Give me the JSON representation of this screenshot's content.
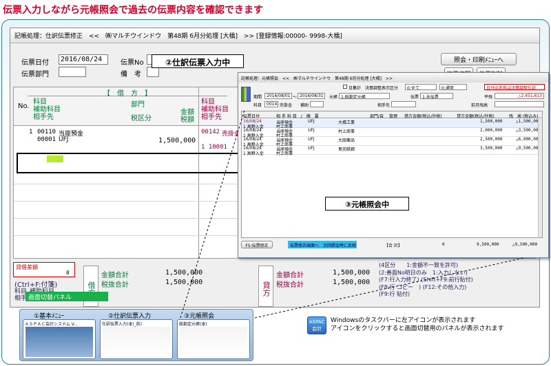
{
  "header": "伝票入力しながら元帳照会で過去の伝票内容を確認できます",
  "main": {
    "title": "記帳処理：仕訳伝票修正　<<　㈱マルチウインドウ　第48期 6月分処理 [大橋]　>> [登録情報:00000- 9998-大橋]",
    "date_label": "伝票日付",
    "date_value": "2016/08/24",
    "no_label": "伝票No",
    "dept_label": "伝票部門",
    "note_label": "備　考",
    "btn_inquiry": "照会・印刷ﾒﾆｭｰへ",
    "btn_copy": "伝票複写",
    "btn_delete": "伝票削除",
    "col_no": "No.",
    "debit_header": "【　借　方　】",
    "debit_subject": [
      "科目",
      "補助科目",
      "相手先"
    ],
    "debit_dept": "部門",
    "tax_cls": "税区分",
    "amount": "金額",
    "tax_amount": "税額",
    "credit_subject": [
      "科目",
      "補助科目",
      "相手先"
    ],
    "row": {
      "no": "1",
      "code1": "00110",
      "name1": "当座預金",
      "code2": "00001",
      "name2": "UFJ",
      "amount": "1,500,000",
      "ccode": "00142",
      "cname": "売掛金",
      "ccode2": "1 10001"
    },
    "diff_label": "貸借差額",
    "diff_value": "0",
    "hint_ctrl": "(Ctrl+F:付箋)",
    "hint_trunc1": "科目",
    "hint_trunc2": "補助科目",
    "hint_trunc3": "相手先",
    "debit_side": "借方",
    "credit_side": "貸方",
    "total_label": "金額合計",
    "tax_total_label": "税抜合計",
    "debit_total": "1,500,000",
    "debit_tax_total": "1,500,000",
    "credit_total": "1,500,000",
    "credit_tax_total": "1,500,000",
    "keys": [
      "(4区分　　1:金額不一致を許可)",
      "(2:善面No明日のみ　1:入力しない)",
      "(F7:行入力終了) (Shift+F9:前行貼付)",
      "(F8:行 コピー　) (F12:その他入力)",
      "(F9:行 貼付)"
    ],
    "panel": "画面切替パネル"
  },
  "callouts": {
    "journal": "②仕訳伝票入力中",
    "ledger": "③元帳照会中"
  },
  "ledger": {
    "title": "記帳処理：元帳照会　<<　㈱マルチウインドウ　第48期 6月分処理 [大橋]　>>",
    "daily_total": "日集計",
    "adj_label": "決算調整表示区分",
    "adj_value": "0:全て",
    "adj_value2": "0:通常",
    "red_note": "日付の赤色は決算調整仕訳",
    "period_label": "期間",
    "period_from": "2016/08/01",
    "period_to": "2016/08/31",
    "ledger_label": "元帳",
    "ledger_value": "1:総勘定元帳",
    "voucher_label": "伝票",
    "voucher_value": "1:未伝票",
    "balance_label": "平残",
    "balance_value": "△2,451,613",
    "subject_label": "科目",
    "subject_code": "00142",
    "subject_name": "売掛金",
    "aux_label": "補助",
    "partner_label": "相手先",
    "prev_label": "前月残高",
    "cols": [
      "伝票日付",
      "相 手 科 目　/　摘　要",
      "部門/自",
      "管理",
      "借方金額(税込/外税)",
      "貸方金額(税込/外税)",
      "残　高 (税込み)"
    ],
    "rows": [
      {
        "date": "16/08/24",
        "sub": "1 高野入金",
        "acct": "当座預金",
        "memo": "村上商事",
        "bank": "UFJ",
        "partner": "大橋工業",
        "debit": "",
        "credit": "1,500,000",
        "balance": "△1,500,000"
      },
      {
        "date": "16/08/24",
        "sub": "1 高野入金",
        "acct": "当座預金",
        "memo": "村上商事",
        "bank": "UFJ",
        "partner": "村上商事",
        "debit": "",
        "credit": "2,000,000",
        "balance": "△3,500,000"
      },
      {
        "date": "16/08/24",
        "sub": "1 高野入金",
        "acct": "当座預金",
        "memo": "村上商事",
        "bank": "UFJ",
        "partner": "大田薬品",
        "debit": "",
        "credit": "2,500,000",
        "balance": "△6,000,000"
      },
      {
        "date": "16/08/24",
        "sub": "1 高野入金",
        "acct": "当座預金",
        "memo": "村上商事",
        "bank": "UFJ",
        "partner": "島羽鉄鋼",
        "debit": "",
        "credit": "3,500,000",
        "balance": "△9,500,000"
      }
    ],
    "f5": "F5:伝票修正",
    "status": "伝票修正画面へ　次回照会時に反映",
    "sum_label": "【合 計】",
    "sum_debit": "0",
    "sum_credit": "9,500,000",
    "sum_balance": "△9,500,000"
  },
  "taskbar": {
    "t1": "①基本ﾒﾆｭｰ",
    "t2": "②仕訳伝票入力",
    "t3": "③元帳照会",
    "w1": "ＡＳＰＡＣ会計システム V...",
    "w2": "仕訳伝票入力(本)_前)",
    "w3": "総勘定元帳(本)"
  },
  "aspac": {
    "line1": "ASPAC",
    "line2": "会計"
  },
  "note": [
    "Windowsのタスクバーに左アイコンが表示されます",
    "アイコンをクリックすると画面切替用のパネルが表示されます"
  ],
  "colors": {
    "title_red": "#d4002a",
    "accent": "#2a7a9a",
    "debit_red": "#a00040"
  }
}
